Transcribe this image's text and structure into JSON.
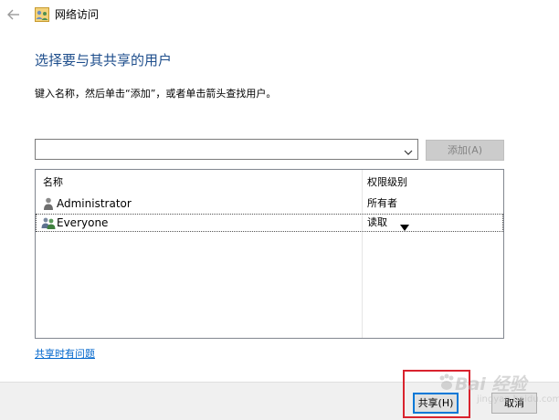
{
  "window": {
    "title": "网络访问"
  },
  "dialog": {
    "heading": "选择要与其共享的用户",
    "instructions": "键入名称，然后单击“添加”，或者单击箭头查找用户。",
    "user_input": {
      "value": "",
      "placeholder": ""
    },
    "add_label": "添加(A)",
    "table": {
      "columns": [
        "名称",
        "权限级别"
      ],
      "rows": [
        {
          "icon": "user-icon",
          "name": "Administrator",
          "permission": "所有者",
          "has_dropdown": false
        },
        {
          "icon": "user-group-icon",
          "name": "Everyone",
          "permission": "读取",
          "has_dropdown": true
        }
      ]
    },
    "help_link": "共享时有问题",
    "share_label": "共享(H)",
    "cancel_label": "取消"
  },
  "watermark": {
    "text": "Bai 经验",
    "sub": "jingyan.baidu.com"
  },
  "colors": {
    "heading": "#1e4e8c",
    "link": "#0066cc",
    "highlight": "#d9232e",
    "default_button_border": "#0078d7",
    "footer_bg": "#f0f0f0"
  }
}
